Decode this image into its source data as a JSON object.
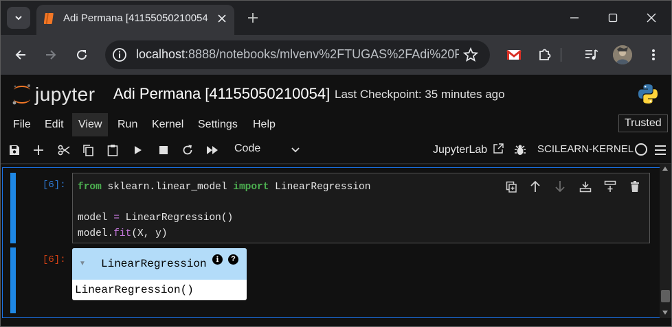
{
  "browser": {
    "tab_title": "Adi Permana [41155050210054]",
    "url_host": "localhost",
    "url_rest": ":8888/notebooks/mlvenv%2FTUGAS%2FAdi%20P..."
  },
  "jupyter": {
    "logo_text": "jupyter",
    "notebook_title": "Adi Permana [41155050210054]",
    "checkpoint": "Last Checkpoint: 35 minutes ago",
    "menu": [
      "File",
      "Edit",
      "View",
      "Run",
      "Kernel",
      "Settings",
      "Help"
    ],
    "trusted": "Trusted",
    "cell_type": "Code",
    "jupyterlab_link": "JupyterLab",
    "kernel_name": "SCILEARN-KERNEL"
  },
  "cell": {
    "in_prompt": "[6]:",
    "out_prompt": "[6]:",
    "code_lines": [
      "from sklearn.linear_model import LinearRegression",
      "",
      "model = LinearRegression()",
      "model.fit(X, y)"
    ],
    "output_header": "LinearRegression",
    "output_repr": "LinearRegression()",
    "info_glyph": "i",
    "help_glyph": "?"
  },
  "colors": {
    "accent_blue": "#1e88e5",
    "keyword_green": "#4caf50",
    "operator_purple": "#c678dd",
    "estimator_header": "#b3dcf9"
  }
}
